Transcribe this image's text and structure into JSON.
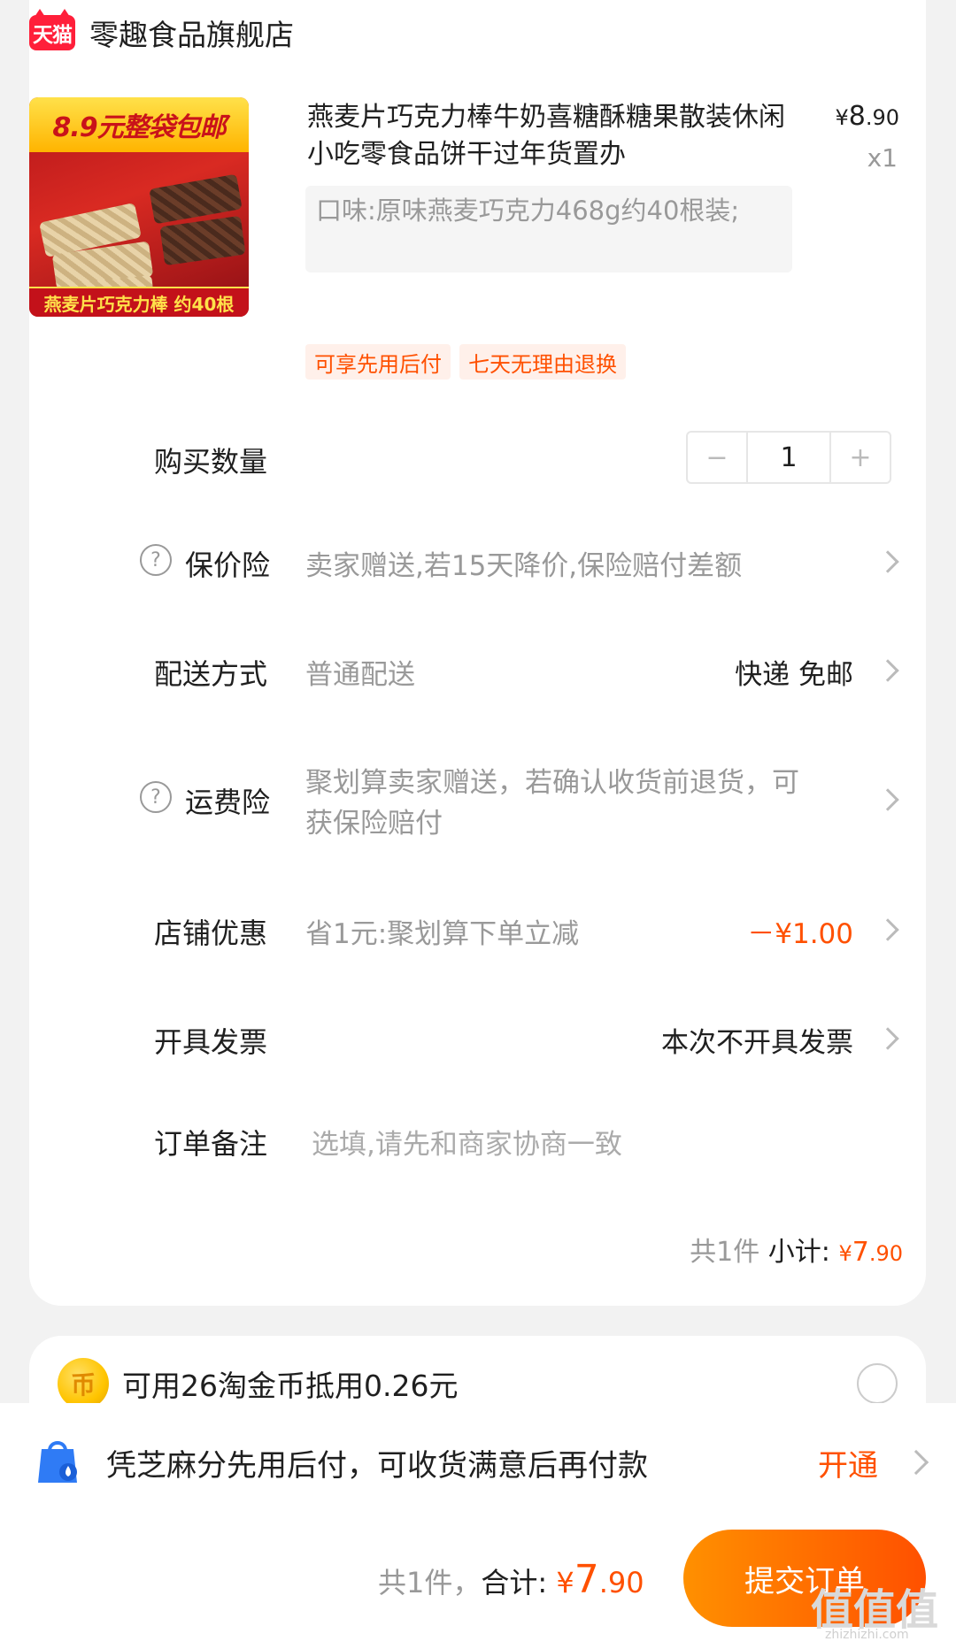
{
  "store": {
    "badge": "天猫",
    "name": "零趣食品旗舰店"
  },
  "product": {
    "image_banner_top": "8.9元整袋包邮",
    "image_banner_bottom": "燕麦片巧克力棒 约40根",
    "title": "燕麦片巧克力棒牛奶喜糖酥糖果散装休闲小吃零食品饼干过年货置办",
    "price_symbol": "¥",
    "price_int": "8",
    "price_dec": ".90",
    "quantity_label": "x1",
    "spec": "口味:原味燕麦巧克力468g约40根装;",
    "tags": [
      "可享先用后付",
      "七天无理由退换"
    ]
  },
  "quantity_row": {
    "label": "购买数量",
    "minus": "−",
    "value": "1",
    "plus": "+"
  },
  "price_protection": {
    "icon_text": "?",
    "label": "保价险",
    "desc": "卖家赠送,若15天降价,保险赔付差额"
  },
  "shipping": {
    "label": "配送方式",
    "desc": "普通配送",
    "value": "快递 免邮"
  },
  "freight_insurance": {
    "icon_text": "?",
    "label": "运费险",
    "desc_line1": "聚划算卖家赠送，若确认收货前退货，可",
    "desc_line2": "获保险赔付"
  },
  "store_discount": {
    "label": "店铺优惠",
    "desc": "省1元:聚划算下单立减",
    "value": "－¥1.00"
  },
  "invoice": {
    "label": "开具发票",
    "value": "本次不开具发票"
  },
  "note": {
    "label": "订单备注",
    "placeholder": "选填,请先和商家协商一致"
  },
  "subtotal": {
    "count": "共1件",
    "label": "小计:",
    "symbol": "¥",
    "int": "7",
    "dec": ".90"
  },
  "coins": {
    "icon_text": "币",
    "text": "可用26淘金币抵用0.26元"
  },
  "pay_later": {
    "text": "凭芝麻分先用后付，可收货满意后再付款",
    "link": "开通"
  },
  "footer": {
    "count": "共1件，",
    "label": "合计:",
    "symbol": "¥",
    "int": "7",
    "dec": ".90",
    "submit": "提交订单"
  },
  "watermark": {
    "logo": "值值值",
    "url": "zhizhizhi.com"
  },
  "colors": {
    "accent": "#ff5000",
    "tmall_red": "#ff1f3a"
  }
}
